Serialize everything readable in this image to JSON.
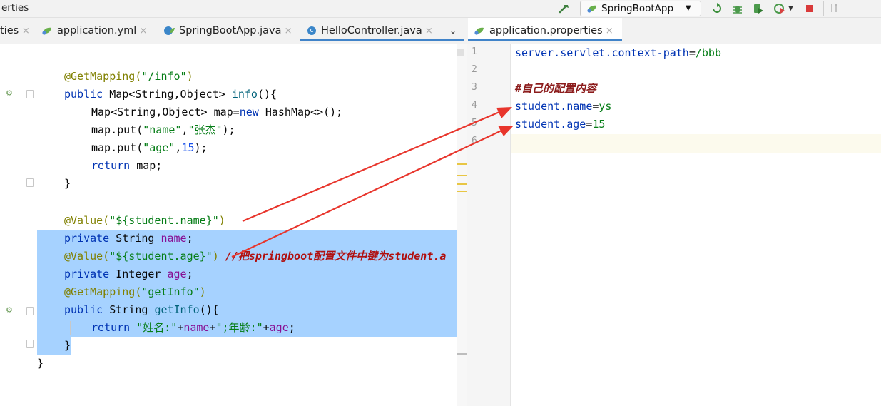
{
  "window": {
    "title_fragment": "erties"
  },
  "toolbar": {
    "run_config": "SpringBootApp",
    "icons": [
      "hammer-icon",
      "run-config-leaf-icon",
      "rerun-icon",
      "debug-icon",
      "coverage-icon",
      "profile-icon",
      "stop-icon",
      "vcs-icon"
    ]
  },
  "tabs": {
    "left": [
      {
        "label": "ties",
        "active": false
      },
      {
        "label": "application.yml",
        "active": false
      },
      {
        "label": "SpringBootApp.java",
        "active": false
      },
      {
        "label": "HelloController.java",
        "active": true
      }
    ],
    "right": [
      {
        "label": "application.properties",
        "active": true
      }
    ]
  },
  "left_editor": {
    "lines": {
      "l1_ann": "@GetMapping(",
      "l1_str": "\"/info\"",
      "l1_end": ")",
      "l2_kw": "public",
      "l2_type": " Map<String,Object> ",
      "l2_fn": "info",
      "l2_end": "(){",
      "l3": "Map<String,Object> map=",
      "l3_kw": "new",
      "l3_end": " HashMap<>();",
      "l4_a": "map.put(",
      "l4_s1": "\"name\"",
      "l4_c": ",",
      "l4_s2": "\"张杰\"",
      "l4_e": ");",
      "l5_a": "map.put(",
      "l5_s1": "\"age\"",
      "l5_c": ",",
      "l5_n": "15",
      "l5_e": ");",
      "l6_kw": "return",
      "l6_e": " map;",
      "l7": "}",
      "l9_ann": "@Value(",
      "l9_str": "\"${student.name}\"",
      "l9_end": ")",
      "l10_kw": "private",
      "l10_t": " String ",
      "l10_f": "name",
      "l10_e": ";",
      "l11_ann": "@Value(",
      "l11_str": "\"${student.age}\"",
      "l11_end": ") ",
      "l11_cmt": "//把springboot配置文件中键为student.a",
      "l12_kw": "private",
      "l12_t": " Integer ",
      "l12_f": "age",
      "l12_e": ";",
      "l13_ann": "@GetMapping(",
      "l13_str": "\"getInfo\"",
      "l13_end": ")",
      "l14_kw": "public",
      "l14_t": " String ",
      "l14_fn": "getInfo",
      "l14_e": "(){",
      "l15_kw": "return",
      "l15_s1": " \"姓名:\"",
      "l15_p1": "+",
      "l15_f1": "name",
      "l15_p2": "+",
      "l15_s2": "\";年龄:\"",
      "l15_p3": "+",
      "l15_f2": "age",
      "l15_e": ";",
      "l16": "}",
      "l17": "}"
    }
  },
  "right_editor": {
    "line_numbers": [
      "1",
      "2",
      "3",
      "4",
      "5",
      "6"
    ],
    "l1_key": "server.servlet.context-path",
    "l1_eq": "=",
    "l1_val": "/bbb",
    "l3_cmt": "#自己的配置内容",
    "l4_key": "student.name",
    "l4_eq": "=",
    "l4_val": "ys",
    "l5_key": "student.age",
    "l5_eq": "=",
    "l5_val": "15"
  },
  "colors": {
    "selection": "#a6d2ff",
    "annotation": "#808000",
    "keyword": "#0033b3",
    "string": "#067d17",
    "arrow": "#e8352c"
  }
}
